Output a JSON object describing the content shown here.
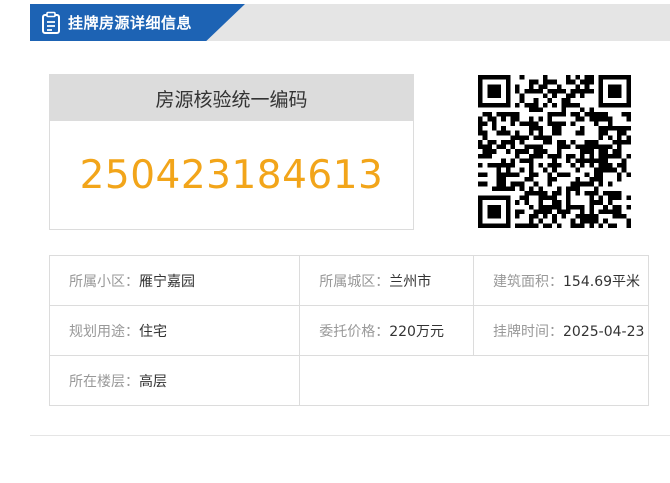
{
  "header": {
    "title": "挂牌房源详细信息",
    "icon": "document-icon"
  },
  "code_box": {
    "title": "房源核验统一编码",
    "value": "250423184613"
  },
  "qr": {
    "icon": "qr-code-icon"
  },
  "info": {
    "community_label": "所属小区：",
    "community_value": "雁宁嘉园",
    "district_label": "所属城区：",
    "district_value": "兰州市",
    "area_label": "建筑面积：",
    "area_value": "154.69平米",
    "usage_label": "规划用途：",
    "usage_value": "住宅",
    "price_label": "委托价格：",
    "price_value": "220万元",
    "listed_label": "挂牌时间：",
    "listed_value": "2025-04-23",
    "floor_label": "所在楼层：",
    "floor_value": "高层"
  },
  "colors": {
    "accent": "#1d63b4",
    "code": "#f2a51a",
    "header_bg": "#e5e5e5"
  }
}
